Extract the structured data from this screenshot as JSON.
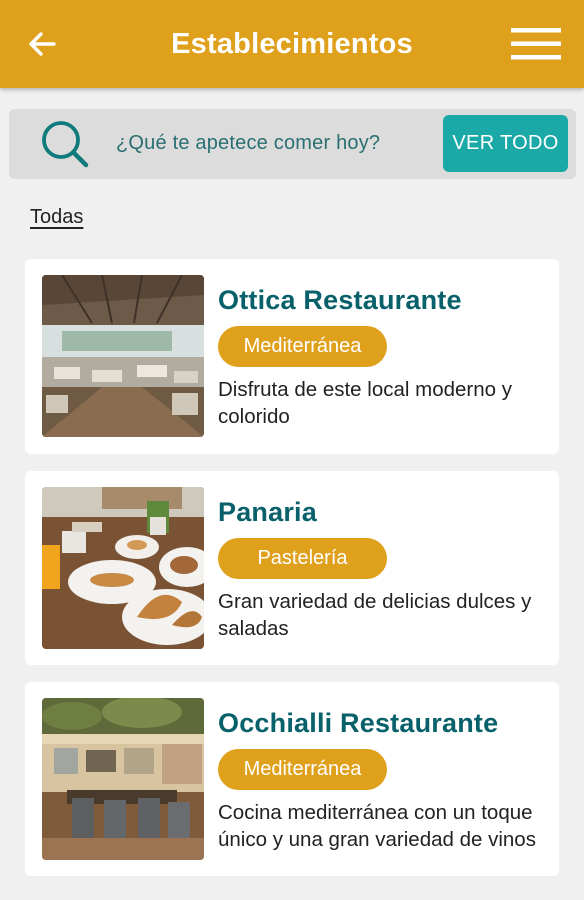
{
  "header": {
    "title": "Establecimientos",
    "back_icon": "arrow-back-icon",
    "menu_icon": "hamburger-menu-icon",
    "color": "#dfa01c"
  },
  "search": {
    "placeholder": "¿Qué te apetece comer hoy?",
    "button_label": "VER TODO",
    "icon": "search-icon",
    "accent": "#1aa9a6"
  },
  "filter": {
    "label": "Todas"
  },
  "establishments": [
    {
      "name": "Ottica Restaurante",
      "category": "Mediterránea",
      "description": "Disfruta de este local moderno y colorido"
    },
    {
      "name": "Panaria",
      "category": "Pastelería",
      "description": "Gran variedad de delicias dulces y saladas"
    },
    {
      "name": "Occhialli Restaurante",
      "category": "Mediterránea",
      "description": "Cocina mediterránea con un toque único y una gran variedad de vinos"
    }
  ]
}
